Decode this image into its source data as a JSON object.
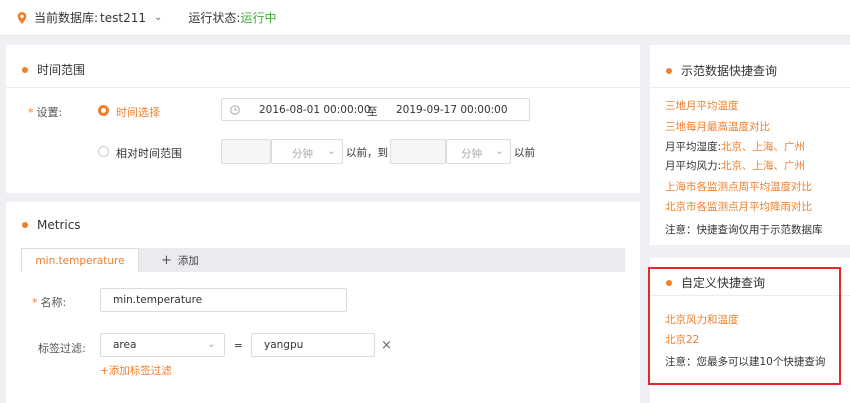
{
  "topbar": {
    "db_label": "当前数据库:",
    "db_name": "test211",
    "status_label": "运行状态:",
    "status_value": "运行中"
  },
  "time_range": {
    "title": "时间范围",
    "setting_label": "设置:",
    "option_absolute": "时间选择",
    "start": "2016-08-01 00:00:00",
    "to": "至",
    "end": "2019-09-17 00:00:00",
    "option_relative": "相对时间范围",
    "unit1": "分钟",
    "before_to": "以前，到",
    "unit2": "分钟",
    "before": "以前"
  },
  "metrics": {
    "title": "Metrics",
    "tab_active": "min.temperature",
    "tab_add": "添加",
    "name_label": "名称:",
    "name_value": "min.temperature",
    "filter_label": "标签过滤:",
    "filter_key": "area",
    "equals": "=",
    "filter_value": "yangpu",
    "remove": "×",
    "add_filter": "+添加标签过滤"
  },
  "demo": {
    "title": "示范数据快捷查询",
    "links": [
      "三地月平均温度",
      "三地每月最高温度对比"
    ],
    "humidity_label": "月平均湿度:",
    "humidity_value": "北京、上海、广州",
    "wind_label": "月平均风力:",
    "wind_value": "北京、上海、广州",
    "links2": [
      "上海市各监测点周平均温度对比",
      "北京市各监测点月平均降雨对比"
    ],
    "note": "注意：快捷查询仅用于示范数据库"
  },
  "custom": {
    "title": "自定义快捷查询",
    "links": [
      "北京风力和温度",
      "北京22"
    ],
    "note": "注意：您最多可以建10个快捷查询"
  },
  "colors": {
    "accent": "#f07f2a",
    "status_green": "#3cb035",
    "highlight_red": "#e8262b"
  }
}
